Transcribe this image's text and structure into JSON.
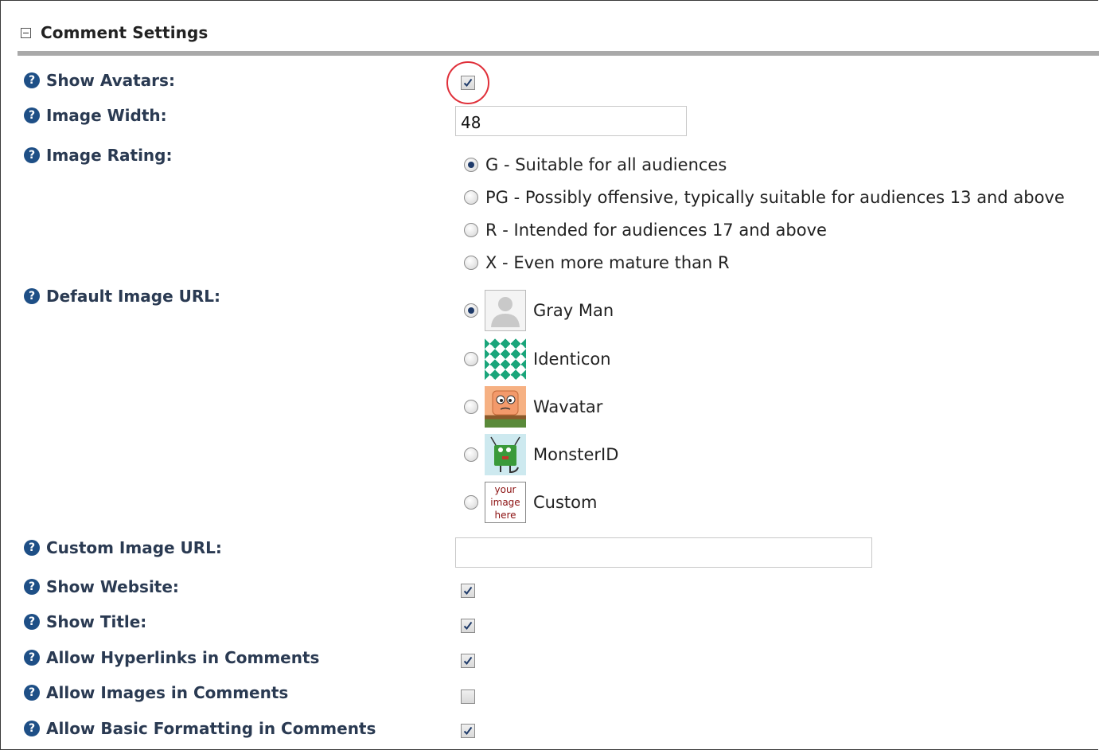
{
  "section": {
    "title": "Comment Settings"
  },
  "labels": {
    "show_avatars": "Show Avatars:",
    "image_width": "Image Width:",
    "image_rating": "Image Rating:",
    "default_image_url": "Default Image URL:",
    "custom_image_url": "Custom Image URL:",
    "show_website": "Show Website:",
    "show_title": "Show Title:",
    "allow_hyperlinks": "Allow Hyperlinks in Comments",
    "allow_images": "Allow Images in Comments",
    "allow_basic_formatting": "Allow Basic Formatting in Comments"
  },
  "help_icon": "?",
  "image_width_value": "48",
  "custom_image_url_value": "",
  "ratings": [
    {
      "label": "G - Suitable for all audiences",
      "selected": true
    },
    {
      "label": "PG - Possibly offensive, typically suitable for audiences 13 and above",
      "selected": false
    },
    {
      "label": "R - Intended for audiences 17 and above",
      "selected": false
    },
    {
      "label": "X - Even more mature than R",
      "selected": false
    }
  ],
  "default_images": [
    {
      "label": "Gray Man",
      "icon": "gray-man-avatar",
      "selected": true
    },
    {
      "label": "Identicon",
      "icon": "identicon-avatar",
      "selected": false
    },
    {
      "label": "Wavatar",
      "icon": "wavatar-avatar",
      "selected": false
    },
    {
      "label": "MonsterID",
      "icon": "monsterid-avatar",
      "selected": false
    },
    {
      "label": "Custom",
      "icon": "custom-avatar",
      "selected": false
    }
  ],
  "custom_avatar_text": [
    "your",
    "image",
    "here"
  ],
  "checkboxes": {
    "show_avatars": true,
    "show_website": true,
    "show_title": true,
    "allow_hyperlinks": true,
    "allow_images": false,
    "allow_basic_formatting": true
  },
  "colors": {
    "label_text": "#2a3a52",
    "help_icon": "#1e4f86",
    "highlight_circle": "#e0303a",
    "rule": "#a9a9a9"
  }
}
